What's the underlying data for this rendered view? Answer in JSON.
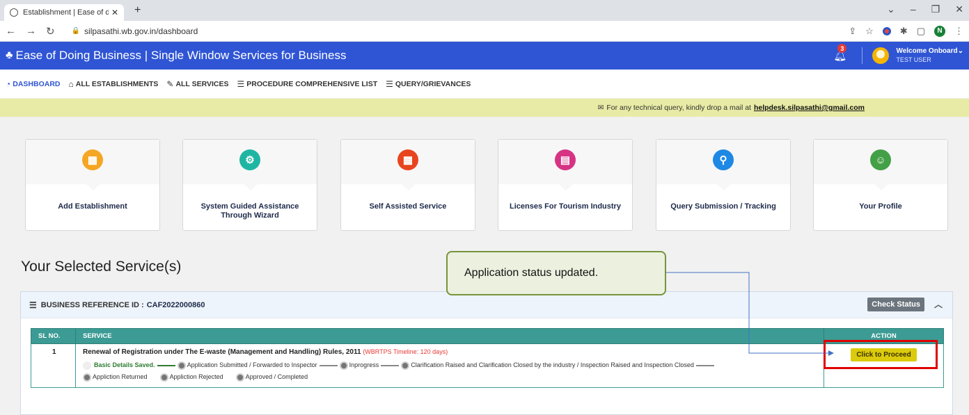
{
  "browser": {
    "tab_title": "Establishment | Ease of doing bu",
    "new_tab": "+",
    "url": "silpasathi.wb.gov.in/dashboard",
    "profile_initial": "N"
  },
  "header": {
    "title": "Ease of Doing Business | Single Window Services for Business",
    "notification_count": "3",
    "welcome": "Welcome Onboard",
    "user": "TEST USER",
    "bg_color": "#2f55d4"
  },
  "topnav": {
    "items": [
      "DASHBOARD",
      "ALL ESTABLISHMENTS",
      "ALL SERVICES",
      "PROCEDURE COMPREHENSIVE LIST",
      "QUERY/GRIEVANCES"
    ]
  },
  "notice": {
    "text": "For any technical query, kindly drop a mail at",
    "email": "helpdesk.silpasathi@gmail.com"
  },
  "cards": [
    {
      "label": "Add Establishment",
      "color": "#f5a623",
      "icon": "building-icon"
    },
    {
      "label": "System Guided Assistance Through Wizard",
      "color": "#1fb5a3",
      "icon": "gear-icon"
    },
    {
      "label": "Self Assisted Service",
      "color": "#e8451f",
      "icon": "grid-icon"
    },
    {
      "label": "Licenses For Tourism Industry",
      "color": "#d63384",
      "icon": "license-icon"
    },
    {
      "label": "Query Submission / Tracking",
      "color": "#1e88e5",
      "icon": "search-icon"
    },
    {
      "label": "Your Profile",
      "color": "#43a047",
      "icon": "profile-icon"
    }
  ],
  "selected": {
    "title": "Your Selected Service(s)",
    "ref_label": "BUSINESS REFERENCE ID :",
    "ref_id": "CAF2022000860",
    "check_status": "Check Status",
    "columns": [
      "SL NO.",
      "SERVICE",
      "ACTION"
    ],
    "row": {
      "sl": "1",
      "service": "Renewal of Registration under The E-waste (Management and Handling) Rules, 2011",
      "timeline": "(WBRTPS Timeline: 120 days)",
      "steps": [
        "Basic Details Saved.",
        "Application Submitted / Forwarded to Inspector",
        "Inprogress",
        "Clarification Raised and Clarification Closed by the industry / Inspection Raised and Inspection Closed",
        "Appliction Returned",
        "Appliction Rejected",
        "Approved / Completed"
      ],
      "action": "Click to Proceed"
    }
  },
  "callout": {
    "text": "Application status updated."
  }
}
